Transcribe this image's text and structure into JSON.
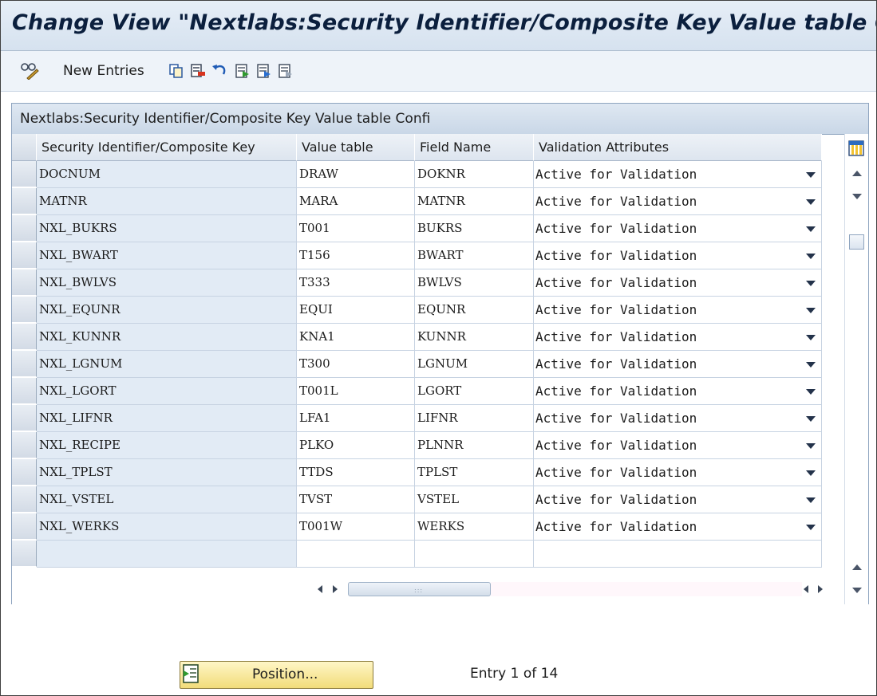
{
  "window": {
    "title": "Change View \"Nextlabs:Security Identifier/Composite Key Value table Co"
  },
  "toolbar": {
    "new_entries_label": "New Entries",
    "icons": [
      "display-change-icon",
      "copy-as-icon",
      "delete-icon",
      "undo-change-icon",
      "select-all-icon",
      "select-block-icon",
      "deselect-all-icon"
    ]
  },
  "panel": {
    "title": "Nextlabs:Security Identifier/Composite Key Value table Confi"
  },
  "table": {
    "columns": [
      "Security Identifier/Composite Key",
      "Value table",
      "Field Name",
      "Validation Attributes"
    ],
    "rows": [
      [
        "DOCNUM",
        "DRAW",
        "DOKNR",
        "Active for Validation"
      ],
      [
        "MATNR",
        "MARA",
        "MATNR",
        "Active for Validation"
      ],
      [
        "NXL_BUKRS",
        "T001",
        "BUKRS",
        "Active for Validation"
      ],
      [
        "NXL_BWART",
        "T156",
        "BWART",
        "Active for Validation"
      ],
      [
        "NXL_BWLVS",
        "T333",
        "BWLVS",
        "Active for Validation"
      ],
      [
        "NXL_EQUNR",
        "EQUI",
        "EQUNR",
        "Active for Validation"
      ],
      [
        "NXL_KUNNR",
        "KNA1",
        "KUNNR",
        "Active for Validation"
      ],
      [
        "NXL_LGNUM",
        "T300",
        "LGNUM",
        "Active for Validation"
      ],
      [
        "NXL_LGORT",
        "T001L",
        "LGORT",
        "Active for Validation"
      ],
      [
        "NXL_LIFNR",
        "LFA1",
        "LIFNR",
        "Active for Validation"
      ],
      [
        "NXL_RECIPE",
        "PLKO",
        "PLNNR",
        "Active for Validation"
      ],
      [
        "NXL_TPLST",
        "TTDS",
        "TPLST",
        "Active for Validation"
      ],
      [
        "NXL_VSTEL",
        "TVST",
        "VSTEL",
        "Active for Validation"
      ],
      [
        "NXL_WERKS",
        "T001W",
        "WERKS",
        "Active for Validation"
      ],
      [
        "",
        "",
        "",
        ""
      ]
    ]
  },
  "footer": {
    "position_button_label": "Position...",
    "entry_text": "Entry 1 of 14"
  },
  "colors": {
    "title_bar": "#d6e2ef",
    "key_column": "#e2ebf5",
    "position_button": "#f2dc7a"
  }
}
